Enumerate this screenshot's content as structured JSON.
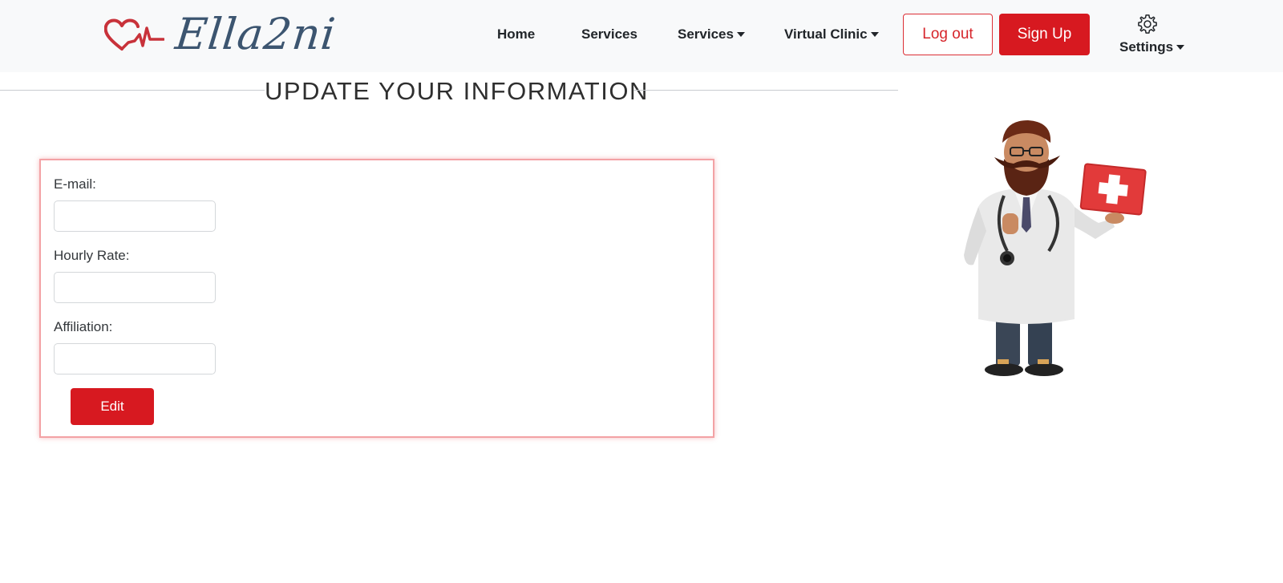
{
  "brand": {
    "name": "Ella2ni"
  },
  "nav": {
    "home": "Home",
    "services": "Services",
    "services_dropdown": "Services",
    "virtual_clinic": "Virtual Clinic",
    "logout": "Log out",
    "signup": "Sign Up",
    "settings": "Settings"
  },
  "page": {
    "title": "UPDATE YOUR INFORMATION"
  },
  "form": {
    "email_label": "E-mail:",
    "email_value": "",
    "hourly_rate_label": "Hourly Rate:",
    "hourly_rate_value": "",
    "affiliation_label": "Affiliation:",
    "affiliation_value": "",
    "edit_label": "Edit"
  },
  "colors": {
    "accent": "#d71920",
    "brand_text": "#3c5570",
    "navbar_bg": "#f8f9fa",
    "card_border": "#f3a2a5"
  },
  "icons": {
    "logo": "heart-pulse-icon",
    "settings": "gear-icon",
    "dropdown": "caret-down-icon"
  }
}
